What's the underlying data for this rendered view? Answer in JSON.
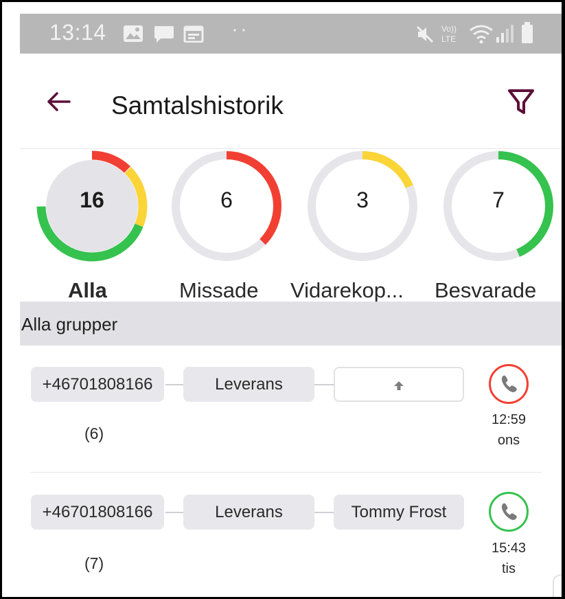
{
  "status_bar": {
    "time": "13:14",
    "icons": [
      "image-icon",
      "message-icon",
      "calendar-icon",
      "more-dots-icon",
      "mute-icon",
      "volte-icon",
      "wifi-icon",
      "signal-icon",
      "battery-icon"
    ],
    "more": "··",
    "volte": "Vo)) LTE"
  },
  "app_bar": {
    "title": "Samtalshistorik",
    "back_icon": "arrow-left-icon",
    "filter_icon": "filter-icon",
    "accent_color": "#5c1039"
  },
  "stats": [
    {
      "count": "16",
      "label": "Alla",
      "selected": true
    },
    {
      "count": "6",
      "label": "Missade",
      "selected": false
    },
    {
      "count": "3",
      "label": "Vidarekop...",
      "selected": false
    },
    {
      "count": "7",
      "label": "Besvarade",
      "selected": false
    }
  ],
  "colors": {
    "missed": "#f23f33",
    "forwarded": "#fbd437",
    "answered": "#35c24e",
    "track": "#e6e6ea"
  },
  "group_filter": "Alla grupper",
  "calls": [
    {
      "number": "+46701808166",
      "count": "(6)",
      "group": "Leverans",
      "agent": "",
      "agent_icon": "arrow-up-icon",
      "status": "missed",
      "time": "12:59",
      "day": "ons"
    },
    {
      "number": "+46701808166",
      "count": "(7)",
      "group": "Leverans",
      "agent": "Tommy Frost",
      "status": "answered",
      "time": "15:43",
      "day": "tis"
    }
  ]
}
